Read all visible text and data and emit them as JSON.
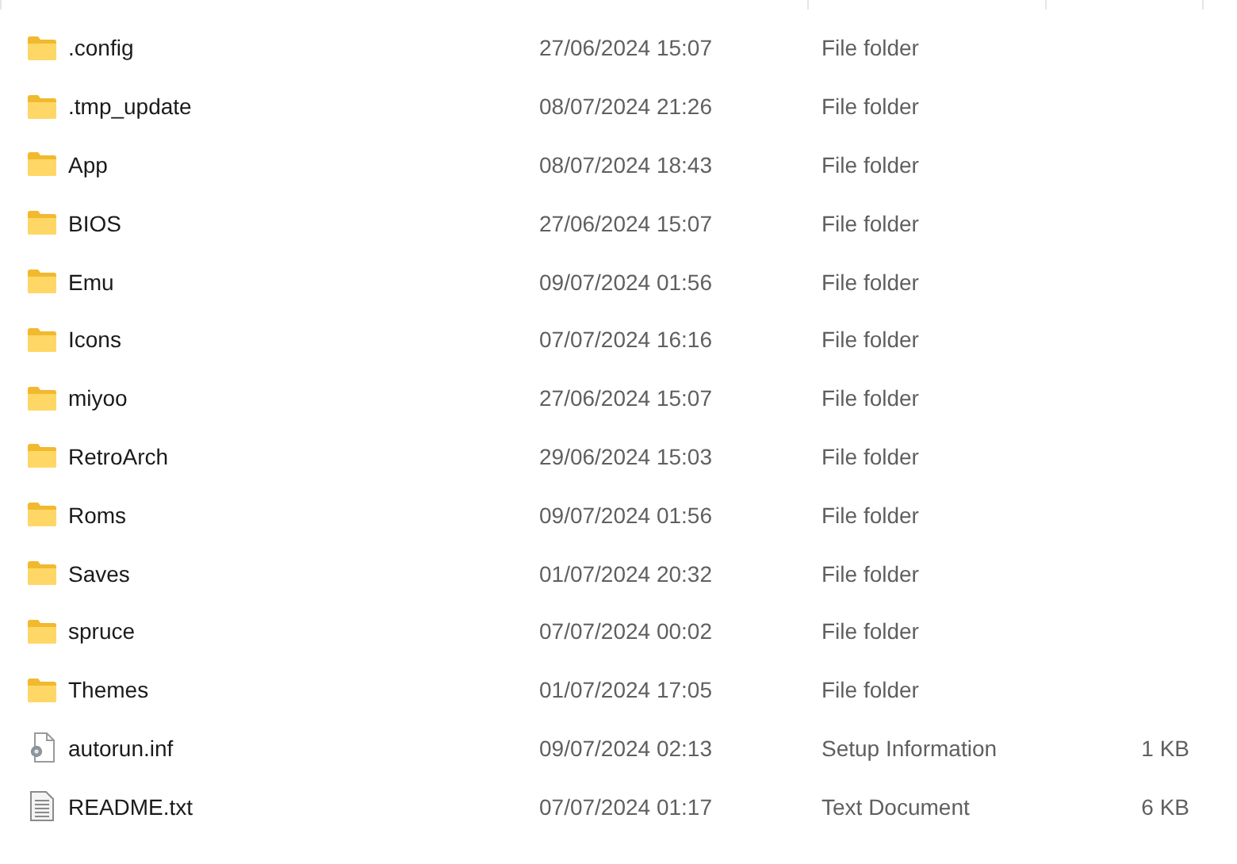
{
  "files": [
    {
      "name": ".config",
      "date": "27/06/2024 15:07",
      "type": "File folder",
      "kind": "folder"
    },
    {
      "name": ".tmp_update",
      "date": "08/07/2024 21:26",
      "type": "File folder",
      "kind": "folder"
    },
    {
      "name": "App",
      "date": "08/07/2024 18:43",
      "type": "File folder",
      "kind": "folder"
    },
    {
      "name": "BIOS",
      "date": "27/06/2024 15:07",
      "type": "File folder",
      "kind": "folder"
    },
    {
      "name": "Emu",
      "date": "09/07/2024 01:56",
      "type": "File folder",
      "kind": "folder"
    },
    {
      "name": "Icons",
      "date": "07/07/2024 16:16",
      "type": "File folder",
      "kind": "folder"
    },
    {
      "name": "miyoo",
      "date": "27/06/2024 15:07",
      "type": "File folder",
      "kind": "folder"
    },
    {
      "name": "RetroArch",
      "date": "29/06/2024 15:03",
      "type": "File folder",
      "kind": "folder"
    },
    {
      "name": "Roms",
      "date": "09/07/2024 01:56",
      "type": "File folder",
      "kind": "folder"
    },
    {
      "name": "Saves",
      "date": "01/07/2024 20:32",
      "type": "File folder",
      "kind": "folder"
    },
    {
      "name": "spruce",
      "date": "07/07/2024 00:02",
      "type": "File folder",
      "kind": "folder"
    },
    {
      "name": "Themes",
      "date": "01/07/2024 17:05",
      "type": "File folder",
      "kind": "folder"
    },
    {
      "name": "autorun.inf",
      "date": "09/07/2024 02:13",
      "type": "Setup Information",
      "size": "1 KB",
      "kind": "settings"
    },
    {
      "name": "README.txt",
      "date": "07/07/2024 01:17",
      "type": "Text Document",
      "size": "6 KB",
      "kind": "text"
    }
  ]
}
